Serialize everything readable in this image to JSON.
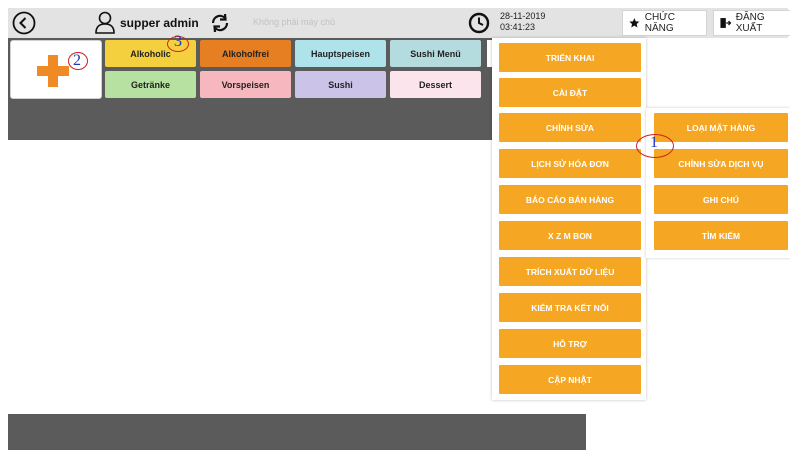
{
  "topbar": {
    "user_name": "supper admin",
    "server_status": "Không phải máy chủ",
    "date": "28-11-2019",
    "time": "03:41:23",
    "functions_label": "CHỨC NĂNG",
    "logout_label": "ĐĂNG XUẤT"
  },
  "categories": [
    {
      "label": "Alkoholic",
      "color": "#f4d03f"
    },
    {
      "label": "Alkoholfrei",
      "color": "#e67e22"
    },
    {
      "label": "Hauptspeisen",
      "color": "#aee3ec"
    },
    {
      "label": "Sushi Menü",
      "color": "#b4dcdf"
    },
    {
      "label": "Getränke",
      "color": "#b7e1a1"
    },
    {
      "label": "Vorspeisen",
      "color": "#f7b7bf"
    },
    {
      "label": "Sushi",
      "color": "#cbc4e8"
    },
    {
      "label": "Dessert",
      "color": "#fbe4ec"
    }
  ],
  "menu": {
    "items": [
      "TRIỂN KHAI",
      "CÀI ĐẶT",
      "CHỈNH SỬA",
      "LỊCH SỬ HÓA ĐƠN",
      "BÁO CÁO BÁN HÀNG",
      "X Z M BON",
      "TRÍCH XUẤT DỮ LIỆU",
      "KIỂM TRA KẾT NỐI",
      "HỖ TRỢ",
      "CẬP NHẬT"
    ],
    "submenu_items": [
      "LOẠI MẶT HÀNG",
      "CHỈNH SỬA DỊCH VỤ",
      "GHI CHÚ",
      "TÌM KIẾM"
    ]
  },
  "annotations": [
    "1",
    "2",
    "3"
  ],
  "colors": {
    "accent": "#f5a623",
    "dark_panel": "#5b5b5b",
    "topbar": "#e3e3e3"
  }
}
